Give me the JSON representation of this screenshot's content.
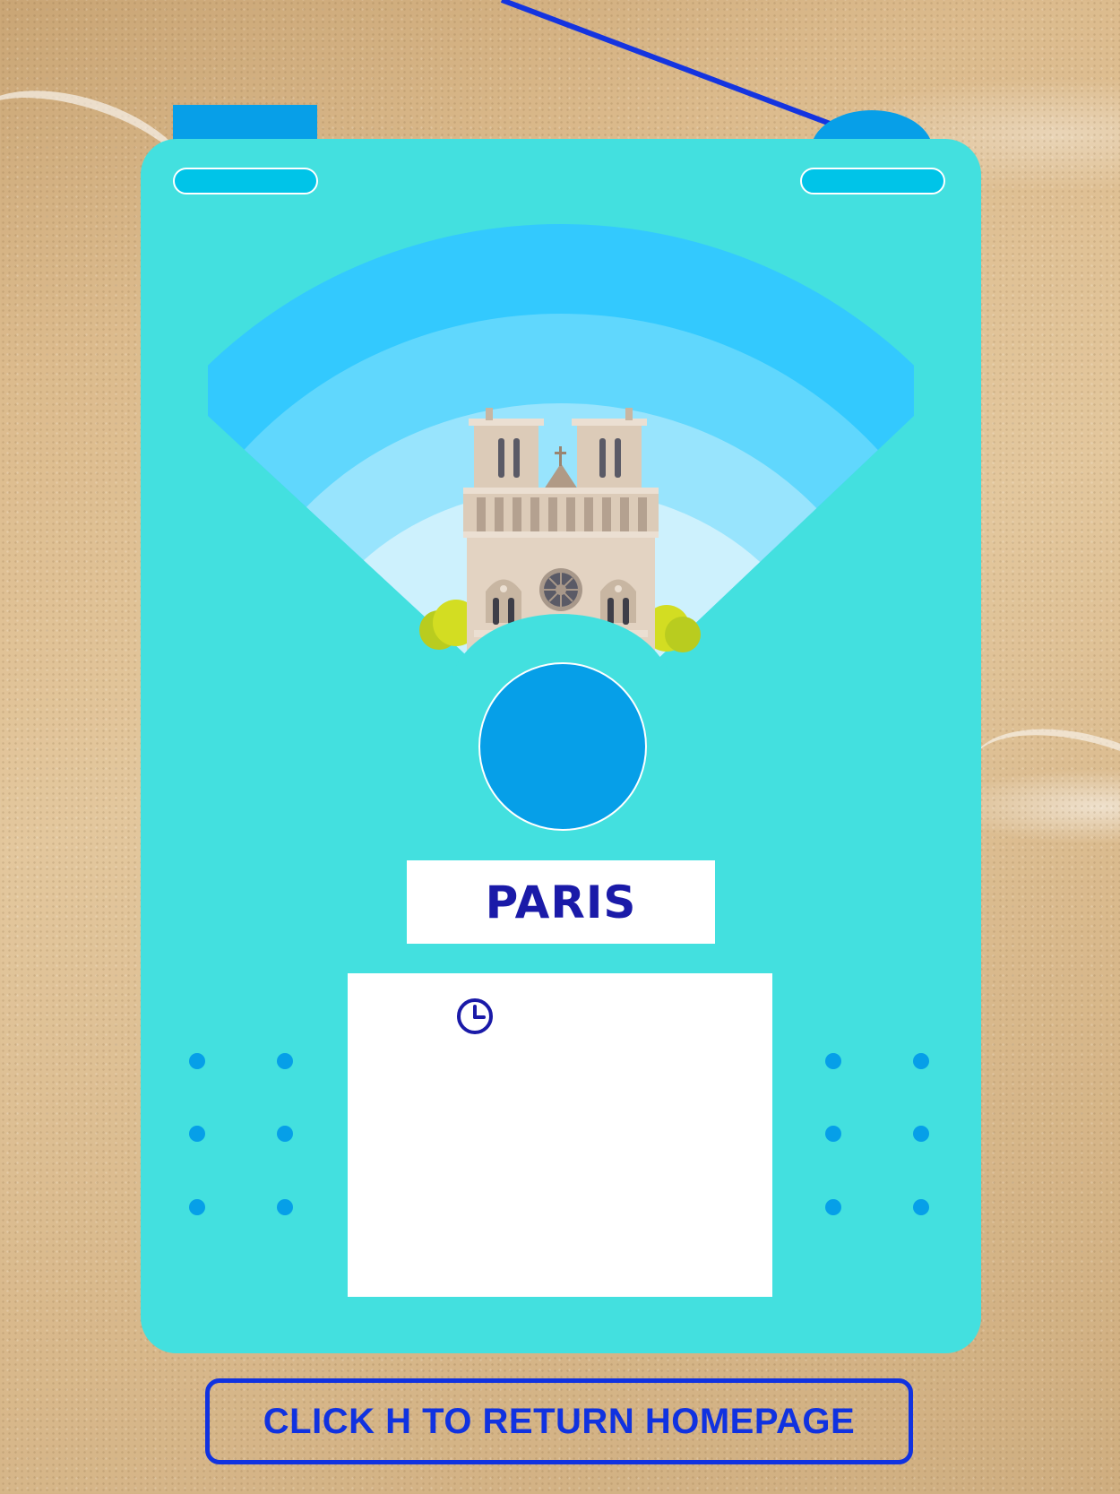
{
  "city": {
    "name": "PARIS",
    "landmark_icon": "notre-dame-cathedral"
  },
  "info_panel": {
    "icon": "clock-icon"
  },
  "return_button": {
    "label": "CLICK H TO RETURN HOMEPAGE"
  },
  "colors": {
    "radio_body": "#43e0df",
    "accent_blue": "#069fe8",
    "text_navy": "#1a1aa8",
    "button_blue": "#1032e0",
    "fan_outer": "#33c9fe",
    "fan_mid": "#60d7fd",
    "fan_inner": "#98e4fd",
    "fan_core": "#cdf1fd"
  }
}
